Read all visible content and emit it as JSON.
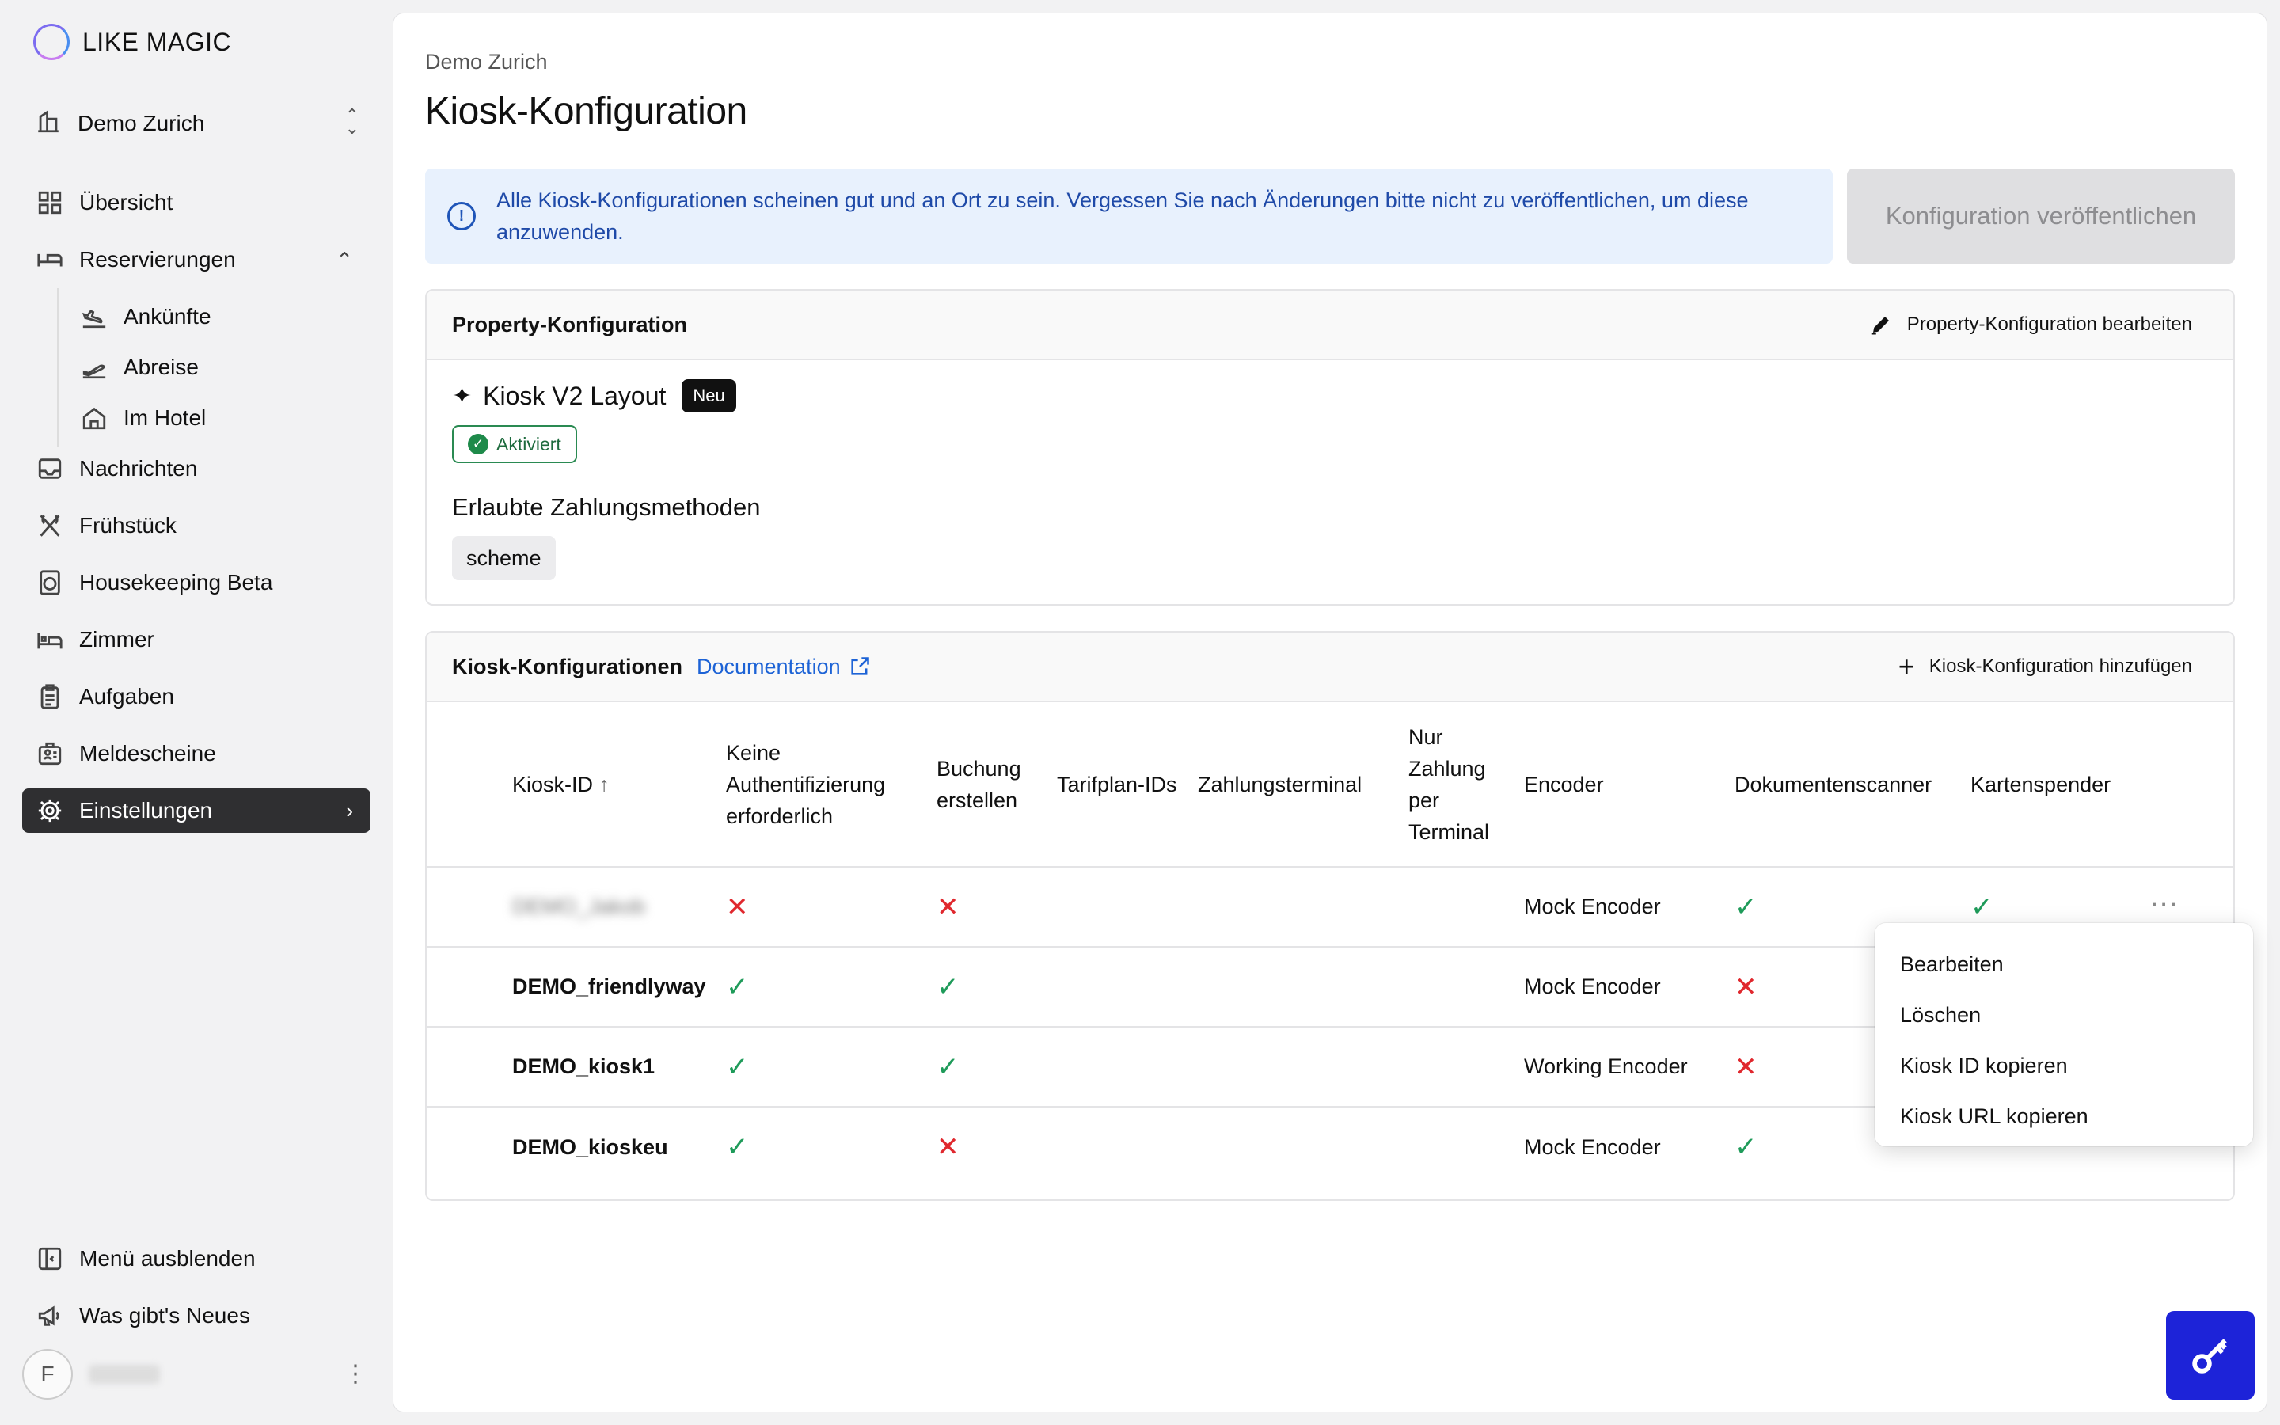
{
  "brand": {
    "name": "LIKE MAGIC"
  },
  "property_switcher": {
    "name": "Demo Zurich"
  },
  "sidebar": {
    "items": [
      {
        "label": "Übersicht",
        "icon": "grid-icon"
      },
      {
        "label": "Reservierungen",
        "icon": "bed-icon",
        "expanded": true
      },
      {
        "label": "Ankünfte",
        "icon": "plane-landing-icon",
        "sub": true
      },
      {
        "label": "Abreise",
        "icon": "plane-takeoff-icon",
        "sub": true
      },
      {
        "label": "Im Hotel",
        "icon": "home-icon",
        "sub": true
      },
      {
        "label": "Nachrichten",
        "icon": "inbox-icon"
      },
      {
        "label": "Frühstück",
        "icon": "cutlery-icon"
      },
      {
        "label": "Housekeeping Beta",
        "icon": "washing-machine-icon"
      },
      {
        "label": "Zimmer",
        "icon": "bed-room-icon"
      },
      {
        "label": "Aufgaben",
        "icon": "clipboard-icon"
      },
      {
        "label": "Meldescheine",
        "icon": "id-card-icon"
      },
      {
        "label": "Einstellungen",
        "icon": "gear-icon",
        "active": true
      }
    ],
    "bottom": [
      {
        "label": "Menü ausblenden",
        "icon": "sidebar-collapse-icon"
      },
      {
        "label": "Was gibt's Neues",
        "icon": "megaphone-icon"
      }
    ],
    "user": {
      "initial": "F"
    }
  },
  "header": {
    "breadcrumb": "Demo Zurich",
    "title": "Kiosk-Konfiguration"
  },
  "alert": {
    "text": "Alle Kiosk-Konfigurationen scheinen gut und an Ort zu sein. Vergessen Sie nach Änderungen bitte nicht zu veröffentlichen, um diese anzuwenden."
  },
  "publish_button": {
    "label": "Konfiguration veröffentlichen"
  },
  "property_config": {
    "title": "Property-Konfiguration",
    "edit_label": "Property-Konfiguration bearbeiten",
    "kiosk_v2": {
      "title": "Kiosk V2 Layout",
      "badge": "Neu",
      "status": "Aktiviert"
    },
    "payment_title": "Erlaubte Zahlungsmethoden",
    "payment_methods": [
      "scheme"
    ]
  },
  "kiosk_configs": {
    "title": "Kiosk-Konfigurationen",
    "doc_link": "Documentation",
    "add_label": "Kiosk-Konfiguration hinzufügen",
    "columns": {
      "kiosk_id": "Kiosk-ID",
      "no_auth": "Keine Authentifizierung erforderlich",
      "create_booking": "Buchung erstellen",
      "rate_plan": "Tarifplan-IDs",
      "payment_terminal": "Zahlungsterminal",
      "terminal_only": "Nur Zahlung per Terminal",
      "encoder": "Encoder",
      "doc_scanner": "Dokumentenscanner",
      "card_dispenser": "Kartenspender"
    },
    "rows": [
      {
        "id": "DEMO_Jakob",
        "blurred": true,
        "no_auth": false,
        "create_booking": false,
        "encoder": "Mock Encoder",
        "doc_scanner": true,
        "card_dispenser": true
      },
      {
        "id": "DEMO_friendlyway",
        "blurred": false,
        "no_auth": true,
        "create_booking": true,
        "encoder": "Mock Encoder",
        "doc_scanner": false,
        "card_dispenser": null
      },
      {
        "id": "DEMO_kiosk1",
        "blurred": false,
        "no_auth": true,
        "create_booking": true,
        "encoder": "Working Encoder",
        "doc_scanner": false,
        "card_dispenser": null
      },
      {
        "id": "DEMO_kioskeu",
        "blurred": false,
        "no_auth": true,
        "create_booking": false,
        "encoder": "Mock Encoder",
        "doc_scanner": true,
        "card_dispenser": null
      }
    ]
  },
  "context_menu": {
    "items": [
      "Bearbeiten",
      "Löschen",
      "Kiosk ID kopieren",
      "Kiosk URL kopieren"
    ]
  },
  "colors": {
    "accent": "#1d23d8",
    "success": "#1f9b5a",
    "error": "#e0282e",
    "info": "#1f55b8"
  }
}
